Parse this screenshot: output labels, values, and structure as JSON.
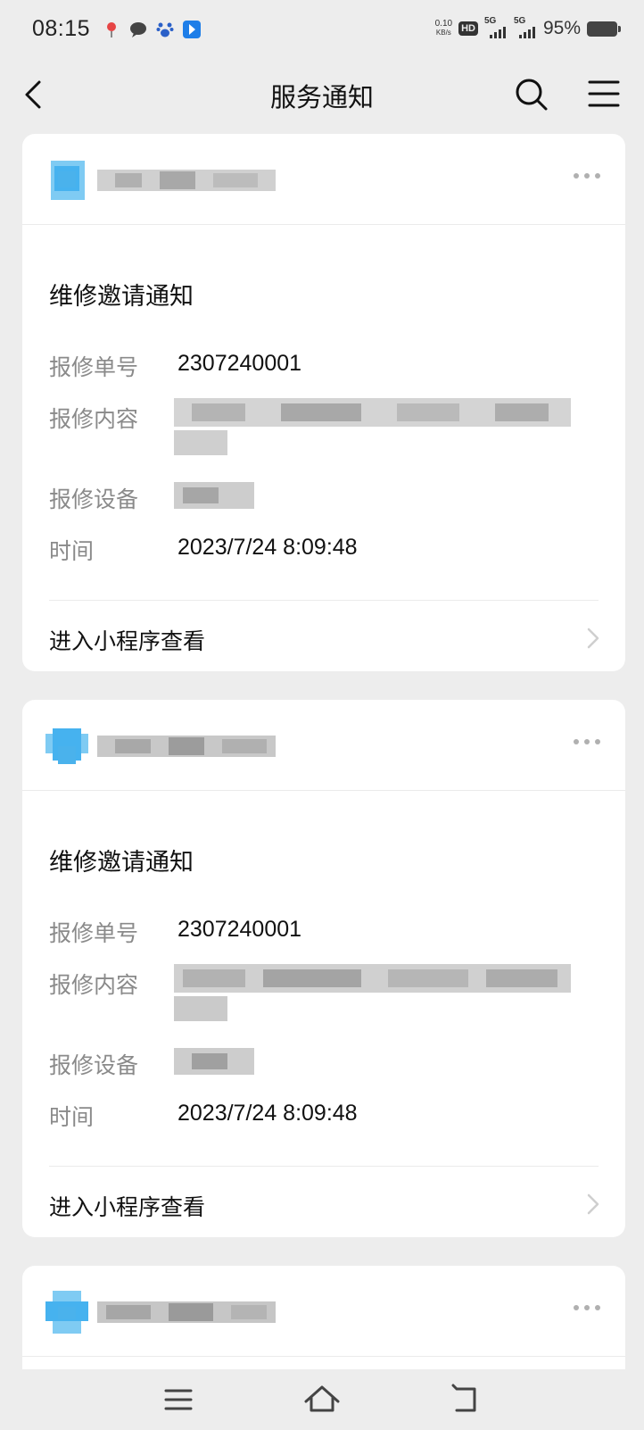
{
  "status_bar": {
    "time": "08:15",
    "net_speed_value": "0.10",
    "net_speed_unit": "KB/s",
    "hd_label": "HD",
    "sim1_label": "5G",
    "sim2_label": "5G",
    "battery_percent": "95%",
    "icons": [
      "map-pin-icon",
      "chat-bubble-icon",
      "paw-icon",
      "app-badge-icon"
    ]
  },
  "nav": {
    "title": "服务通知",
    "icons": [
      "back-arrow-icon",
      "search-icon",
      "menu-icon"
    ]
  },
  "notifications": [
    {
      "title": "维修邀请通知",
      "fields": [
        {
          "label": "报修单号",
          "value": "2307240001"
        },
        {
          "label": "报修内容",
          "value": ""
        },
        {
          "label": "报修设备",
          "value": ""
        },
        {
          "label": "时间",
          "value": "2023/7/24 8:09:48"
        }
      ],
      "link": "进入小程序查看"
    },
    {
      "title": "维修邀请通知",
      "fields": [
        {
          "label": "报修单号",
          "value": "2307240001"
        },
        {
          "label": "报修内容",
          "value": ""
        },
        {
          "label": "报修设备",
          "value": ""
        },
        {
          "label": "时间",
          "value": "2023/7/24 8:09:48"
        }
      ],
      "link": "进入小程序查看"
    }
  ],
  "colors": {
    "background": "#ededed",
    "card": "#ffffff",
    "label": "#8a8a8a",
    "text": "#111111",
    "avatar_blue": "#4ab2ec"
  },
  "system_nav": {
    "icons": [
      "recents-icon",
      "home-icon",
      "back-icon"
    ]
  }
}
